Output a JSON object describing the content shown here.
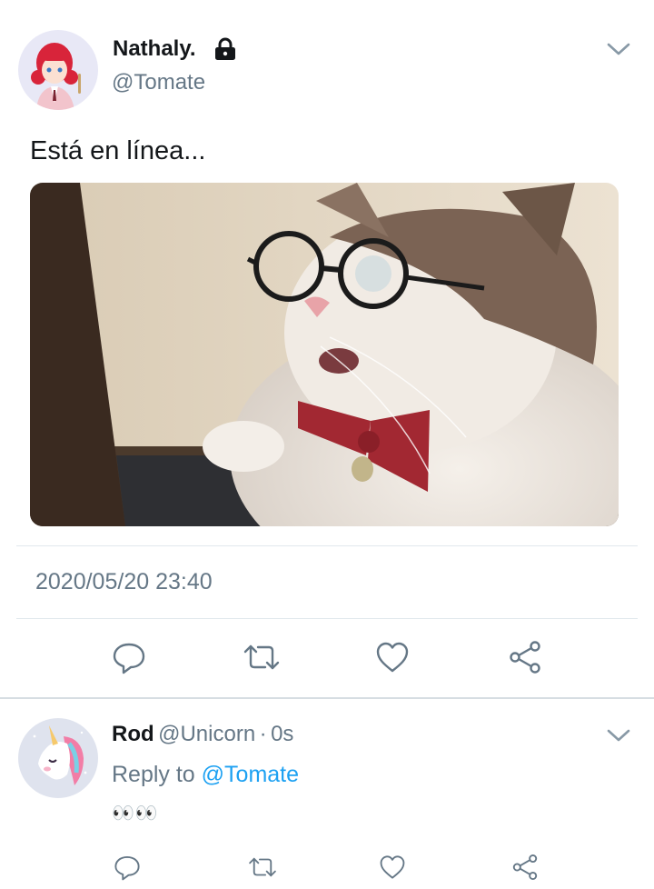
{
  "tweet": {
    "display_name": "Nathaly.",
    "handle": "@Tomate",
    "text": "Está en línea...",
    "timestamp": "2020/05/20 23:40",
    "locked": true
  },
  "actions": [
    "reply-icon",
    "retweet-icon",
    "like-icon",
    "share-icon"
  ],
  "reply": {
    "display_name": "Rod",
    "handle": "@Unicorn",
    "separator": "·",
    "time": "0s",
    "reply_to_label": "Reply to",
    "reply_to_handle": "@Tomate",
    "text": "👀👀"
  },
  "colors": {
    "secondary_text": "#657786",
    "link": "#1da1f2",
    "divider": "#e1e8ed"
  }
}
